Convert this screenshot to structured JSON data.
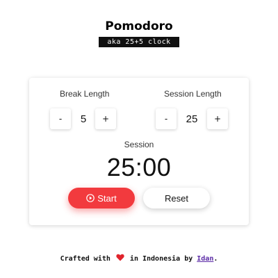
{
  "header": {
    "title": "Pomodoro",
    "subtitle": "aka 25+5 clock"
  },
  "break": {
    "label": "Break Length",
    "decrement": "-",
    "value": "5",
    "increment": "+"
  },
  "session": {
    "label": "Session Length",
    "decrement": "-",
    "value": "25",
    "increment": "+"
  },
  "timer": {
    "label": "Session",
    "time": "25:00"
  },
  "controls": {
    "start_label": "Start",
    "reset_label": "Reset"
  },
  "footer": {
    "prefix": "Crafted with",
    "middle": "in Indonesia by",
    "author": "Idan",
    "suffix": "."
  },
  "colors": {
    "accent": "#f23a3e",
    "link": "#5b2aa6"
  },
  "icons": {
    "start": "play-circle-icon",
    "footer": "heart-icon"
  }
}
